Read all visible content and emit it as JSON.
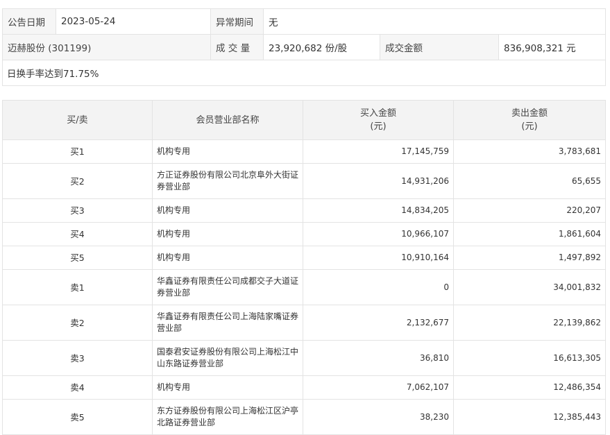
{
  "info": {
    "date_label": "公告日期",
    "date_value": "2023-05-24",
    "period_label": "异常期间",
    "period_value": "无",
    "stock_name": "迈赫股份 (301199)",
    "volume_label": "成 交 量",
    "volume_value": "23,920,682 份/股",
    "amount_label": "成交金额",
    "amount_value": "836,908,321 元",
    "reason": "日换手率达到71.75%"
  },
  "trades": {
    "headers": {
      "side": "买/卖",
      "branch": "会员营业部名称",
      "buy": "买入金额",
      "buy_unit": "(元)",
      "sell": "卖出金额",
      "sell_unit": "(元)"
    },
    "rows": [
      {
        "side": "买1",
        "branch": "机构专用",
        "buy": "17,145,759",
        "sell": "3,783,681"
      },
      {
        "side": "买2",
        "branch": "方正证券股份有限公司北京阜外大街证券营业部",
        "buy": "14,931,206",
        "sell": "65,655"
      },
      {
        "side": "买3",
        "branch": "机构专用",
        "buy": "14,834,205",
        "sell": "220,207"
      },
      {
        "side": "买4",
        "branch": "机构专用",
        "buy": "10,966,107",
        "sell": "1,861,604"
      },
      {
        "side": "买5",
        "branch": "机构专用",
        "buy": "10,910,164",
        "sell": "1,497,892"
      },
      {
        "side": "卖1",
        "branch": "华鑫证券有限责任公司成都交子大道证券营业部",
        "buy": "0",
        "sell": "34,001,832"
      },
      {
        "side": "卖2",
        "branch": "华鑫证券有限责任公司上海陆家嘴证券营业部",
        "buy": "2,132,677",
        "sell": "22,139,862"
      },
      {
        "side": "卖3",
        "branch": "国泰君安证券股份有限公司上海松江中山东路证券营业部",
        "buy": "36,810",
        "sell": "16,613,305"
      },
      {
        "side": "卖4",
        "branch": "机构专用",
        "buy": "7,062,107",
        "sell": "12,486,354"
      },
      {
        "side": "卖5",
        "branch": "东方证券股份有限公司上海松江区沪亭北路证券营业部",
        "buy": "38,230",
        "sell": "12,385,443"
      }
    ]
  }
}
